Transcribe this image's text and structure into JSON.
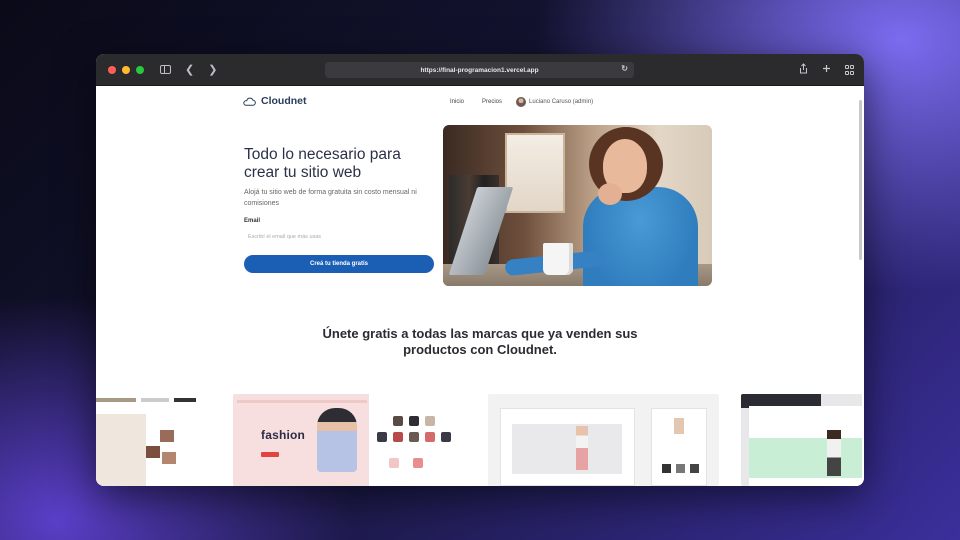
{
  "browser": {
    "url": "https://final-programacion1.vercel.app"
  },
  "site": {
    "brand": "Cloudnet",
    "nav": [
      "Inicio",
      "Precios"
    ],
    "user": "Luciano Caruso (admin)"
  },
  "hero": {
    "title": "Todo lo necesario para crear tu sitio web",
    "subtitle": "Alojá tu sitio web de forma gratuita sin costo mensual ni comisiones",
    "email_label": "Email",
    "email_placeholder": "Escribí el email que más usas",
    "cta": "Creá tu tienda gratis"
  },
  "brands_section": {
    "title": "Únete gratis a todas las marcas que ya venden sus productos con Cloudnet.",
    "showcase": [
      {
        "headline": ""
      },
      {
        "headline": "fashion"
      },
      {
        "headline": ""
      },
      {
        "headline": ""
      }
    ]
  },
  "colors": {
    "primary": "#1b5fb5",
    "brand_text": "#2a3a5c"
  }
}
